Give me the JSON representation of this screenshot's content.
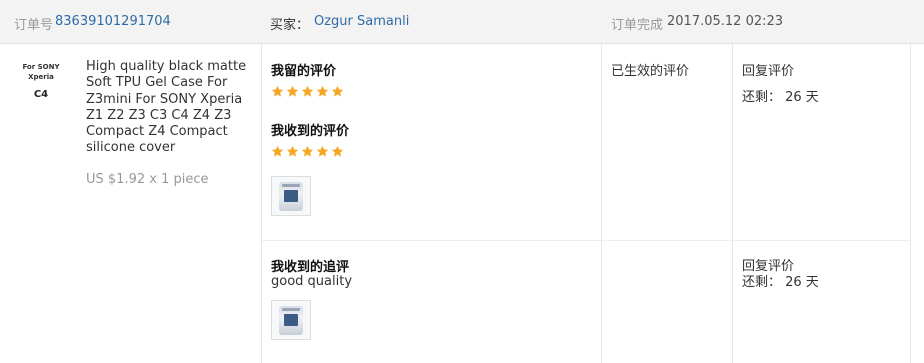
{
  "header": {
    "order_label": "订单号",
    "order_number": "83639101291704",
    "buyer_label": "买家：",
    "buyer_name": "Ozgur Samanli",
    "status_label": "订单完成",
    "status_time": "2017.05.12 02:23"
  },
  "product": {
    "image_brand": "For SONY Xperia",
    "image_model": "C4",
    "title": "High quality black matte Soft TPU Gel Case For Z3mini For SONY Xperia Z1 Z2 Z3 C3 C4 Z4 Z3 Compact Z4 Compact silicone cover",
    "price": "US $1.92 x 1 piece"
  },
  "reviews": {
    "my_review_label": "我留的评价",
    "my_review_rating": 5,
    "received_review_label": "我收到的评价",
    "received_review_rating": 5,
    "followup_label": "我收到的追评",
    "followup_text": "good quality",
    "star_color": "#f5a623"
  },
  "status": {
    "effective_label": "已生效的评价"
  },
  "actions": {
    "reply_label_1": "回复评价",
    "remaining_1": "还剩： 26 天",
    "reply_label_2": "回复评价",
    "remaining_2": "还剩： 26 天"
  }
}
